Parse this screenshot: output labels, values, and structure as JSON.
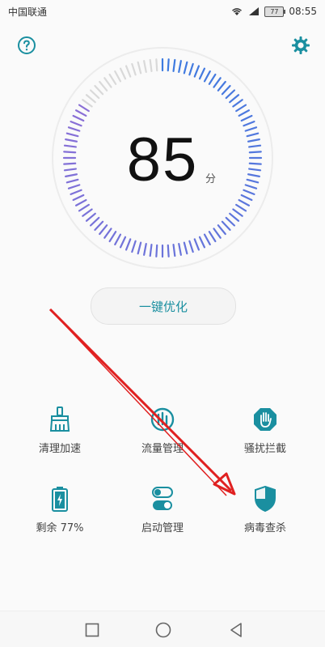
{
  "status_bar": {
    "carrier": "中国联通",
    "battery": "77",
    "time": "08:55"
  },
  "header": {
    "help_icon": "question-circle-icon",
    "settings_icon": "gear-icon"
  },
  "score": {
    "value": "85",
    "unit": "分"
  },
  "optimize_button": {
    "label": "一键优化"
  },
  "tools": [
    {
      "label": "清理加速",
      "icon": "broom-icon"
    },
    {
      "label": "流量管理",
      "icon": "data-usage-icon"
    },
    {
      "label": "骚扰拦截",
      "icon": "hand-block-icon"
    },
    {
      "label": "剩余 77%",
      "icon": "battery-icon"
    },
    {
      "label": "启动管理",
      "icon": "toggle-switch-icon"
    },
    {
      "label": "病毒查杀",
      "icon": "shield-icon"
    }
  ],
  "colors": {
    "accent": "#1a8fa0",
    "dial_active_start": "#3d7be0",
    "dial_active_end": "#8b6fd6",
    "dial_inactive": "#d9d9d9",
    "arrow": "#e02020"
  }
}
